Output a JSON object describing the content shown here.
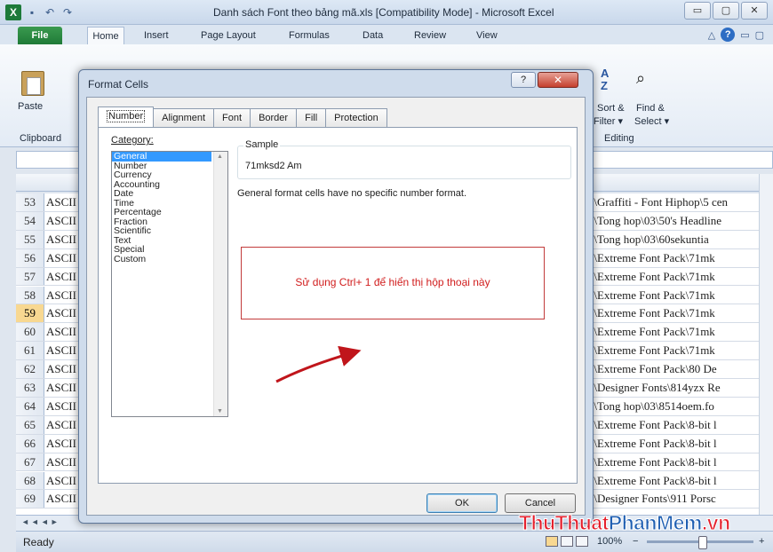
{
  "window": {
    "app_icon": "X",
    "title": "Danh sách Font theo bảng mã.xls  [Compatibility Mode]  -  Microsoft Excel",
    "qat_icons": [
      "save-icon",
      "undo-icon",
      "redo-icon"
    ],
    "controls": [
      "▭",
      "▢",
      "✕"
    ]
  },
  "ribbon": {
    "tabs": [
      "File",
      "Home",
      "Insert",
      "Page Layout",
      "Formulas",
      "Data",
      "Review",
      "View"
    ],
    "groups": {
      "paste": "Paste",
      "clipboard": "Clipboard",
      "sort_filter_1": "Sort &",
      "sort_filter_2": "Filter ▾",
      "find_select_1": "Find &",
      "find_select_2": "Select ▾",
      "editing": "Editing"
    }
  },
  "sheet": {
    "rows": [
      {
        "num": "53",
        "a": "ASCII",
        "b": "I\\Graffiti - Font Hiphop\\5 cen"
      },
      {
        "num": "54",
        "a": "ASCII",
        "b": "I\\Tong hop\\03\\50's Headline"
      },
      {
        "num": "55",
        "a": "ASCII",
        "b": "I\\Tong hop\\03\\60sekuntia"
      },
      {
        "num": "56",
        "a": "ASCII",
        "b": "I\\Extreme Font Pack\\71mk"
      },
      {
        "num": "57",
        "a": "ASCII",
        "b": "I\\Extreme Font Pack\\71mk"
      },
      {
        "num": "58",
        "a": "ASCII",
        "b": "I\\Extreme Font Pack\\71mk"
      },
      {
        "num": "59",
        "a": "ASCII",
        "b": "I\\Extreme Font Pack\\71mk"
      },
      {
        "num": "60",
        "a": "ASCII",
        "b": "I\\Extreme Font Pack\\71mk"
      },
      {
        "num": "61",
        "a": "ASCII",
        "b": "I\\Extreme Font Pack\\71mk"
      },
      {
        "num": "62",
        "a": "ASCII",
        "b": "I\\Extreme Font Pack\\80 De"
      },
      {
        "num": "63",
        "a": "ASCII",
        "b": "I\\Designer Fonts\\814yzx Re"
      },
      {
        "num": "64",
        "a": "ASCII",
        "b": "I\\Tong hop\\03\\8514oem.fo"
      },
      {
        "num": "65",
        "a": "ASCII",
        "b": "I\\Extreme Font Pack\\8-bit l"
      },
      {
        "num": "66",
        "a": "ASCII",
        "b": "I\\Extreme Font Pack\\8-bit l"
      },
      {
        "num": "67",
        "a": "ASCII",
        "b": "I\\Extreme Font Pack\\8-bit l"
      },
      {
        "num": "68",
        "a": "ASCII",
        "b": "I\\Extreme Font Pack\\8-bit l"
      },
      {
        "num": "69",
        "a": "ASCII",
        "b": "I\\Designer Fonts\\911 Porsc"
      }
    ],
    "selected_row": "59"
  },
  "status": {
    "ready": "Ready",
    "zoom": "100%",
    "zoom_minus": "−",
    "zoom_plus": "+",
    "sheet_nav": "◄◄◄►"
  },
  "dialog": {
    "title": "Format Cells",
    "help": "?",
    "close": "✕",
    "tabs": [
      "Number",
      "Alignment",
      "Font",
      "Border",
      "Fill",
      "Protection"
    ],
    "active_tab": "Number",
    "category_label": "Category:",
    "categories": [
      "General",
      "Number",
      "Currency",
      "Accounting",
      "Date",
      "Time",
      "Percentage",
      "Fraction",
      "Scientific",
      "Text",
      "Special",
      "Custom"
    ],
    "selected_category": "General",
    "sample_label": "Sample",
    "sample_value": "71mksd2 Am",
    "description": "General format cells have no specific number format.",
    "annotation": "Sử dụng Ctrl+ 1 để hiển thị hộp thoại này",
    "ok": "OK",
    "cancel": "Cancel"
  },
  "watermark": {
    "part1": "ThuThuat",
    "part2": "PhanMem",
    "part3": ".vn"
  },
  "colors": {
    "file_tab": "#1f7a37",
    "selection": "#3399ff",
    "annotation": "#d11d1d",
    "watermark_red": "#e41f2c",
    "watermark_blue": "#1f5fb2"
  }
}
